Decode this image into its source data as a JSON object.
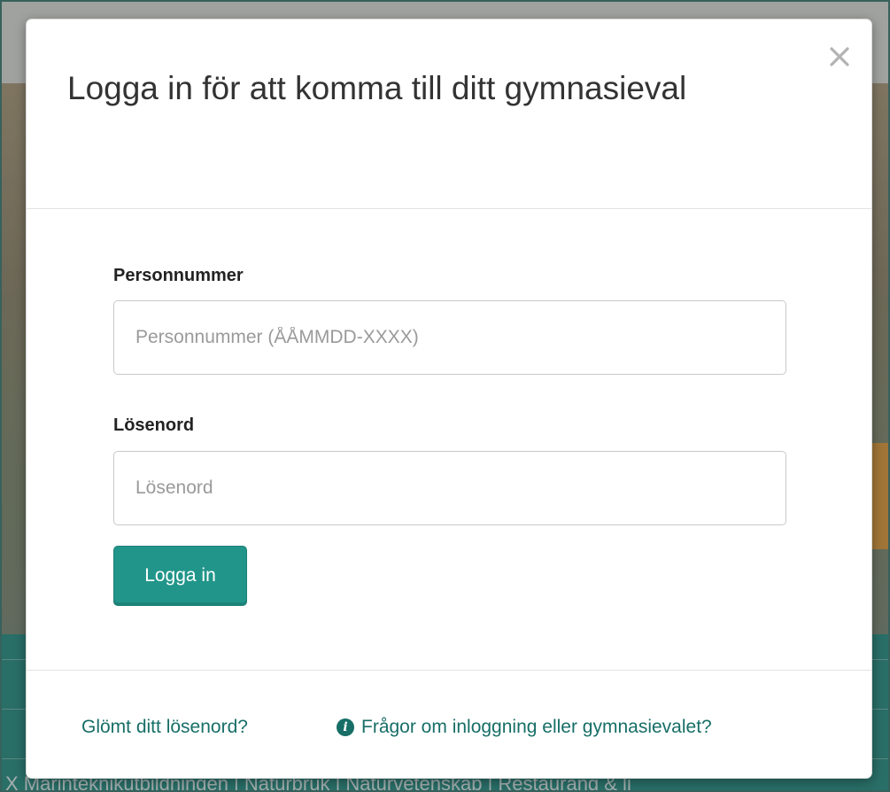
{
  "background": {
    "nav_text": "X Marinteknikutbildningen  |  Naturbruk  |  Naturvetenskap  |  Restaurang & li"
  },
  "modal": {
    "title": "Logga in för att komma till ditt gymnasieval",
    "close_icon": "close-icon",
    "personnummer": {
      "label": "Personnummer",
      "placeholder": "Personnummer (ÅÅMMDD-XXXX)",
      "value": ""
    },
    "password": {
      "label": "Lösenord",
      "placeholder": "Lösenord",
      "value": ""
    },
    "login_button": "Logga in",
    "footer": {
      "forgot_link": "Glömt ditt lösenord?",
      "help_icon": "info-icon",
      "help_link": "Frågor om inloggning eller gymnasievalet?"
    }
  },
  "colors": {
    "accent": "#21958a",
    "link": "#176e67",
    "background_teal": "#2a8f85"
  }
}
